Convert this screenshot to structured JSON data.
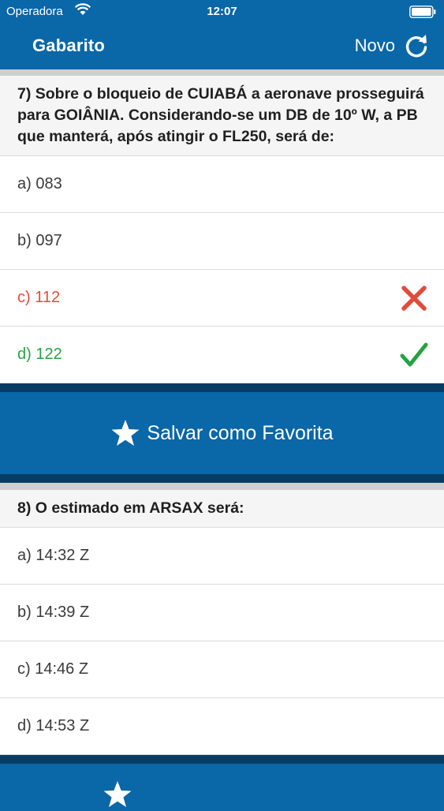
{
  "status_bar": {
    "carrier": "Operadora",
    "time": "12:07"
  },
  "nav": {
    "title": "Gabarito",
    "new_label": "Novo"
  },
  "colors": {
    "primary": "#0a67a8",
    "primary_dark": "#073d64",
    "wrong": "#e24b3b",
    "right": "#25a244"
  },
  "questions": [
    {
      "text": "7) Sobre o bloqueio de CUIABÁ a aeronave prosseguirá para GOIÂNIA. Considerando-se um DB de 10º W, a PB que manterá, após atingir o FL250, será de:",
      "options": [
        {
          "label": "a) 083",
          "state": "none"
        },
        {
          "label": "b) 097",
          "state": "none"
        },
        {
          "label": "c) 112",
          "state": "wrong",
          "icon": "cross-icon"
        },
        {
          "label": "d) 122",
          "state": "right",
          "icon": "check-icon"
        }
      ],
      "favorite_label": "Salvar como Favorita"
    },
    {
      "text": "8) O estimado em ARSAX será:",
      "options": [
        {
          "label": "a) 14:32 Z",
          "state": "none"
        },
        {
          "label": "b) 14:39 Z",
          "state": "none"
        },
        {
          "label": "c) 14:46 Z",
          "state": "none"
        },
        {
          "label": "d) 14:53 Z",
          "state": "none"
        }
      ]
    }
  ]
}
